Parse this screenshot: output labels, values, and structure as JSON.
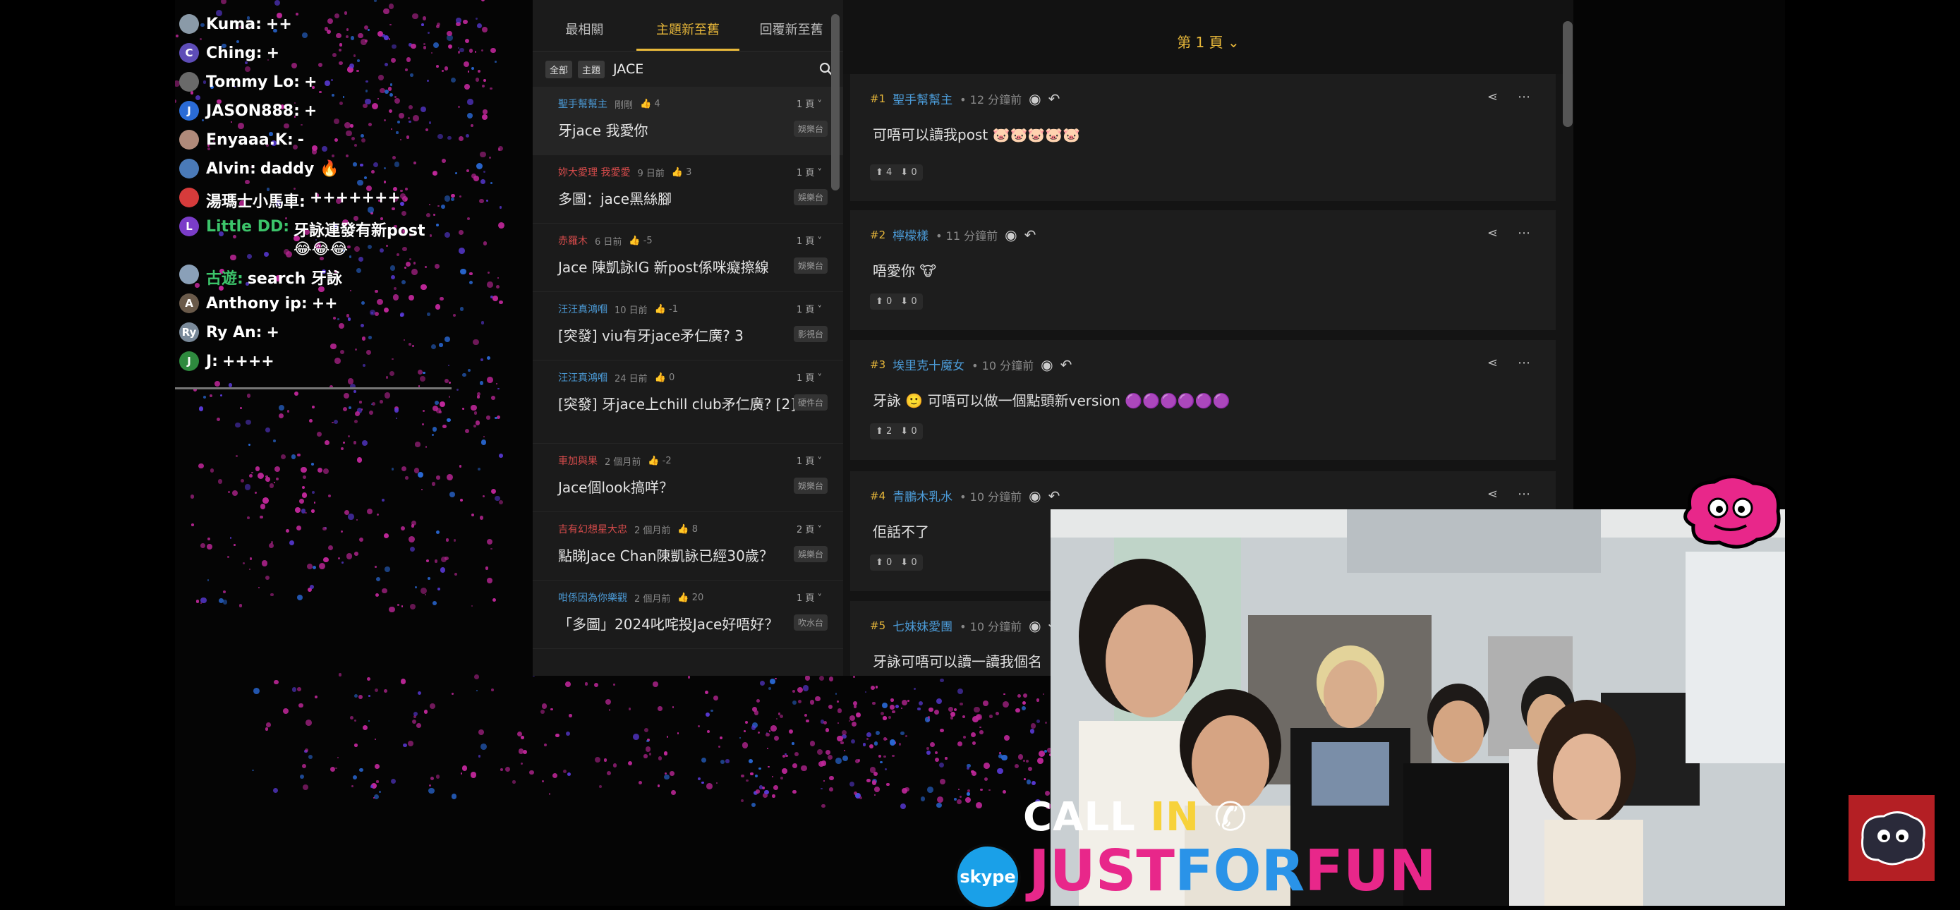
{
  "chat": {
    "messages": [
      {
        "name": "Kuma:",
        "msg": "++",
        "avatar": "",
        "color": "#ffffff",
        "avatar_bg": "#8a9aa8"
      },
      {
        "name": "Ching:",
        "msg": "+",
        "avatar": "C",
        "color": "#ffffff",
        "avatar_bg": "#5e4db8"
      },
      {
        "name": "Tommy Lo:",
        "msg": "+",
        "avatar": "",
        "color": "#ffffff",
        "avatar_bg": "#6a6a6a"
      },
      {
        "name": "JASON888:",
        "msg": "+",
        "avatar": "J",
        "color": "#ffffff",
        "avatar_bg": "#2a6bd6"
      },
      {
        "name": "Enyaaa.K:",
        "msg": "-",
        "avatar": "",
        "color": "#ffffff",
        "avatar_bg": "#b08a7a"
      },
      {
        "name": "Alvin:",
        "msg": "daddy 🔥",
        "avatar": "",
        "color": "#ffffff",
        "avatar_bg": "#4a7ab8"
      },
      {
        "name": "湯瑪士小馬車:",
        "msg": "+++++++",
        "avatar": "",
        "color": "#ffffff",
        "avatar_bg": "#d63b3b"
      },
      {
        "name": "Little DD:",
        "msg": "牙詠連發有新post 😂😂😂",
        "avatar": "L",
        "color": "#3cc46a",
        "avatar_bg": "#7a3cc8"
      },
      {
        "name": "古遊:",
        "msg": "search 牙詠",
        "avatar": "",
        "color": "#3cc46a",
        "avatar_bg": "#8aa0b8"
      },
      {
        "name": "Anthony ip:",
        "msg": "++",
        "avatar": "A",
        "color": "#ffffff",
        "avatar_bg": "#6a5a4a"
      },
      {
        "name": "Ry An:",
        "msg": "+",
        "avatar": "Ry",
        "color": "#ffffff",
        "avatar_bg": "#7a8a9a"
      },
      {
        "name": "J:",
        "msg": "++++",
        "avatar": "J",
        "color": "#ffffff",
        "avatar_bg": "#2e8a3e"
      }
    ]
  },
  "forum_list": {
    "tabs": [
      "最相關",
      "主題新至舊",
      "回覆新至舊"
    ],
    "active_tab": 1,
    "chips": [
      "全部",
      "主題"
    ],
    "search_value": "JACE",
    "threads": [
      {
        "author": "聖手幫幫主",
        "author_color": "#4b9ad6",
        "time": "剛剛",
        "likes": "4",
        "pages": "1 頁",
        "title": "牙jace 我愛你",
        "cat": "娛樂台",
        "hl": true
      },
      {
        "author": "妳大愛理 我愛愛",
        "author_color": "#d64b4b",
        "time": "9 日前",
        "likes": "3",
        "pages": "1 頁",
        "title": "多圖：jace黑絲腳",
        "cat": "娛樂台",
        "hl": false
      },
      {
        "author": "赤羅木",
        "author_color": "#d64b4b",
        "time": "6 日前",
        "likes": "-5",
        "pages": "1 頁",
        "title": "Jace 陳凱詠IG 新post係咪癡擦線",
        "cat": "娛樂台",
        "hl": false
      },
      {
        "author": "汪汪真鴻嗰",
        "author_color": "#4b9ad6",
        "time": "10 日前",
        "likes": "-1",
        "pages": "1 頁",
        "title": "[突發] viu有牙jace矛仁廣? 3",
        "cat": "影視台",
        "hl": false
      },
      {
        "author": "汪汪真鴻嗰",
        "author_color": "#4b9ad6",
        "time": "24 日前",
        "likes": "0",
        "pages": "1 頁",
        "title": "[突發] 牙jace上chill club矛仁廣? [2]",
        "cat": "硬件台",
        "hl": false
      },
      {
        "author": "車加與果",
        "author_color": "#d64b4b",
        "time": "2 個月前",
        "likes": "-2",
        "pages": "1 頁",
        "title": "Jace個look搞咩？",
        "cat": "娛樂台",
        "hl": false
      },
      {
        "author": "吉有幻想星大忠",
        "author_color": "#d64b4b",
        "time": "2 個月前",
        "likes": "8",
        "pages": "2 頁",
        "title": "點睇Jace Chan陳凱詠已經30歲？",
        "cat": "娛樂台",
        "hl": false
      },
      {
        "author": "咁係因為你樂觀",
        "author_color": "#4b9ad6",
        "time": "2 個月前",
        "likes": "20",
        "pages": "1 頁",
        "title": "「多圖」2024叱咤投Jace好唔好？",
        "cat": "吹水台",
        "hl": false
      }
    ]
  },
  "post": {
    "page_label": "第 1 頁",
    "replies": [
      {
        "floor": "#1",
        "author": "聖手幫幫主",
        "time": "12 分鐘前",
        "body": "可唔可以讀我post 🐷🐷🐷🐷🐷",
        "up": "4",
        "down": "0"
      },
      {
        "floor": "#2",
        "author": "檸檬樣",
        "time": "11 分鐘前",
        "body": "唔愛你 🐮",
        "up": "0",
        "down": "0"
      },
      {
        "floor": "#3",
        "author": "埃里克十魔女",
        "time": "10 分鐘前",
        "body": "牙詠 🙂 可唔可以做一個點頭新version 🟣🟣🟣🟣🟣🟣",
        "up": "2",
        "down": "0"
      },
      {
        "floor": "#4",
        "author": "青鵬木乳水",
        "time": "10 分鐘前",
        "body": "佢話不了",
        "up": "0",
        "down": "0"
      },
      {
        "floor": "#5",
        "author": "七妹妹愛團",
        "time": "10 分鐘前",
        "body": "牙詠可唔可以讀一讀我個名",
        "up": "",
        "down": ""
      }
    ]
  },
  "overlay": {
    "callin_a": "CALL ",
    "callin_b": "IN",
    "jff_a": "JUST",
    "jff_b": "FOR",
    "jff_c": "FUN",
    "skype": "skype"
  },
  "colors": {
    "accent_gold": "#e8b83a",
    "link_blue": "#4b9ad6",
    "brand_pink": "#e8278a"
  }
}
